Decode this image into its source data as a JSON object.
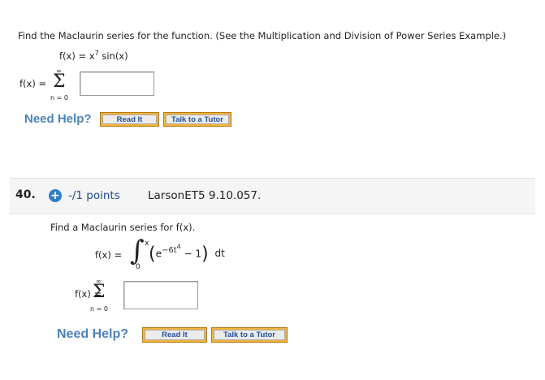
{
  "q39": {
    "prompt": "Find the Maclaurin series for the function. (See the Multiplication and Division of Power Series Example.)",
    "function_lhs": "f(x) = x",
    "function_exp": "7",
    "function_rhs": " sin(x)",
    "series_lhs": "f(x) =",
    "sum_upper": "∞",
    "sum_symbol": "Σ",
    "sum_lower": "n = 0",
    "answer_value": "",
    "need_help": "Need Help?",
    "read_it": "Read It",
    "talk_tutor": "Talk to a Tutor"
  },
  "q40": {
    "number": "40.",
    "plus_icon": "+",
    "points": "-/1 points",
    "source": "LarsonET5 9.10.057.",
    "prompt": "Find a Maclaurin series for f(x).",
    "int_lhs": "f(x) =",
    "int_symbol": "∫",
    "int_upper": "x",
    "int_lower": "0",
    "lparen": "(",
    "base": "e",
    "exp": "−6t",
    "exp_power": "4",
    "minus_one": " − 1",
    "rparen": ")",
    "dt": "dt",
    "series_lhs": "f(x) =",
    "sum_upper": "∞",
    "sum_symbol": "Σ",
    "sum_lower": "n = 0",
    "answer_value": "",
    "need_help": "Need Help?",
    "read_it": "Read It",
    "talk_tutor": "Talk to a Tutor"
  },
  "colors": {
    "need_help": "#4a83b9",
    "button_border": "#f4b43a",
    "button_text": "#234f9a",
    "plus_icon": "#2f7fc8"
  }
}
